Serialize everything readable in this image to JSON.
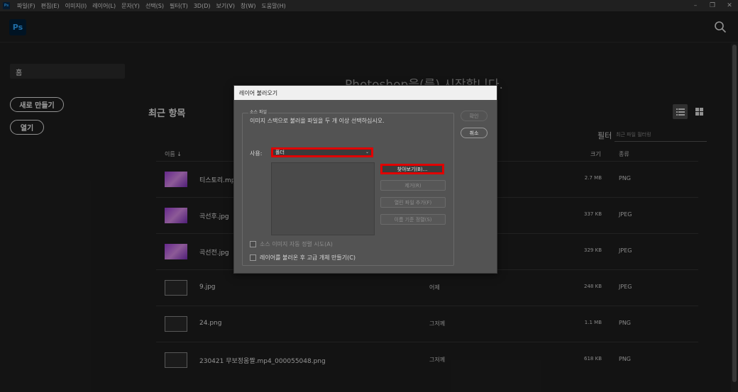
{
  "menu": {
    "app_badge": "Ps",
    "items": [
      "파일(F)",
      "편집(E)",
      "이미지(I)",
      "레이어(L)",
      "문자(Y)",
      "선택(S)",
      "필터(T)",
      "3D(D)",
      "보기(V)",
      "창(W)",
      "도움말(H)"
    ],
    "window_controls": [
      "–",
      "❐",
      "✕"
    ]
  },
  "appbar": {
    "logo": "Ps"
  },
  "sidebar": {
    "home": "홈",
    "new_button": "새로 만들기",
    "open_button": "열기"
  },
  "main": {
    "welcome": "Photoshop을(를) 시작합니다.",
    "recent_title": "최근 항목",
    "filter_label": "필터",
    "filter_placeholder": "최근 파일 필터링",
    "columns": {
      "name": "이름 ↓",
      "size": "크기",
      "kind": "종류"
    },
    "rows": [
      {
        "name": "티스토리.mp",
        "date": "",
        "size": "2.7 MB",
        "kind": "PNG",
        "thumb": "pink"
      },
      {
        "name": "곡선후.jpg",
        "date": "",
        "size": "337 KB",
        "kind": "JPEG",
        "thumb": "pink"
      },
      {
        "name": "곡선전.jpg",
        "date": "",
        "size": "329 KB",
        "kind": "JPEG",
        "thumb": "pink"
      },
      {
        "name": "9.jpg",
        "date": "어제",
        "size": "248 KB",
        "kind": "JPEG",
        "thumb": "dark"
      },
      {
        "name": "24.png",
        "date": "그저께",
        "size": "1.1 MB",
        "kind": "PNG",
        "thumb": "dark"
      },
      {
        "name": "230421 무보정움짤.mp4_000055048.png",
        "date": "그저께",
        "size": "618 KB",
        "kind": "PNG",
        "thumb": "dark"
      }
    ]
  },
  "dialog": {
    "title": "레이어 불러오기",
    "group_label": "소스 파일",
    "instruction": "이미지 스택으로 불러올 파일을 두 개 이상 선택하십시오.",
    "use_label": "사용:",
    "use_value": "폴더",
    "buttons": {
      "browse": "찾아보기(B)...",
      "remove": "제거(R)",
      "add_open": "열린 파일 추가(F)",
      "sort_name": "이름 기준 정렬(S)"
    },
    "ok": "확인",
    "cancel": "취소",
    "checkbox_align": "소스 이미지 자동 정렬 시도(A)",
    "checkbox_smart": "레이어를 불러온 후 고급 개체 만들기(C)"
  },
  "colors": {
    "highlight": "#e00000",
    "ps_blue": "#31a8ff"
  }
}
